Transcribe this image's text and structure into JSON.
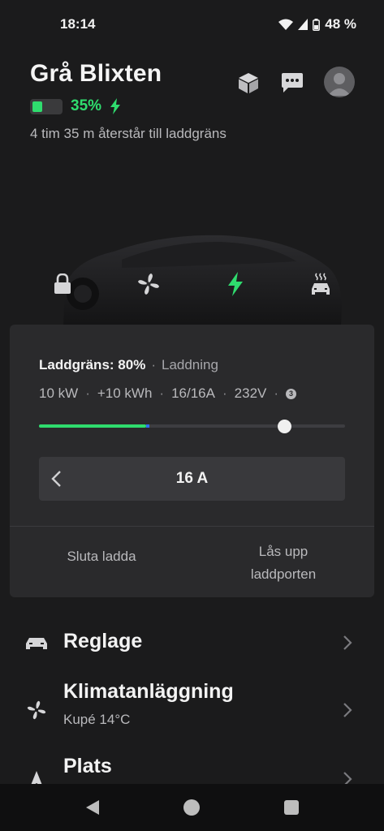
{
  "status_bar": {
    "time": "18:14",
    "battery": "48 %"
  },
  "vehicle": {
    "name": "Grå Blixten",
    "battery_percent": "35%",
    "battery_level": 0.35,
    "remaining": "4 tim 35 m återstår till laddgräns"
  },
  "header_icons": [
    "box-icon",
    "message-icon",
    "profile-icon"
  ],
  "quick_controls": [
    "lock-icon",
    "fan-icon",
    "charging-bolt-icon",
    "seat-heater-icon"
  ],
  "charging": {
    "limit_label": "Laddgräns: 80%",
    "state": "Laddning",
    "stats": [
      "10 kW",
      "+10 kWh",
      "16/16A",
      "232V"
    ],
    "info_badge": "3",
    "charge_level": 0.35,
    "limit_level": 0.8,
    "amperage": "16 A",
    "stop_button": "Sluta ladda",
    "unlock_button_line1": "Lås upp",
    "unlock_button_line2": "laddporten"
  },
  "menu": {
    "controls": {
      "title": "Reglage"
    },
    "climate": {
      "title": "Klimatanläggning",
      "subtitle": "Kupé 14°C"
    },
    "location": {
      "title": "Plats"
    }
  },
  "colors": {
    "accent": "#2fdc6e",
    "background": "#1b1b1c",
    "card": "#2a2a2c"
  }
}
